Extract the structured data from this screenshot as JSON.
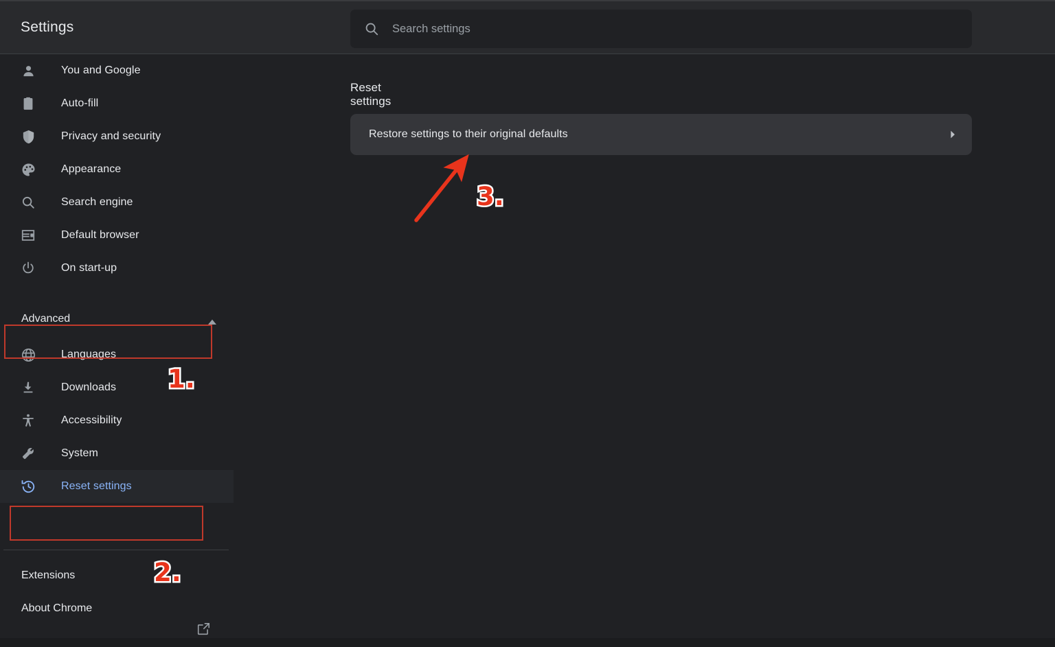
{
  "header": {
    "title": "Settings",
    "search": {
      "placeholder": "Search settings",
      "value": "",
      "icon": "search-icon"
    }
  },
  "sidebar": {
    "items": [
      {
        "label": "You and Google",
        "icon": "person-icon",
        "selected": false
      },
      {
        "label": "Auto-fill",
        "icon": "clipboard-icon",
        "selected": false
      },
      {
        "label": "Privacy and security",
        "icon": "shield-icon",
        "selected": false
      },
      {
        "label": "Appearance",
        "icon": "palette-icon",
        "selected": false
      },
      {
        "label": "Search engine",
        "icon": "magnifier-icon",
        "selected": false
      },
      {
        "label": "Default browser",
        "icon": "browser-window-icon",
        "selected": false
      },
      {
        "label": "On start-up",
        "icon": "power-icon",
        "selected": false
      }
    ],
    "advanced": {
      "label": "Advanced",
      "expanded": true,
      "icon": "chevron-up-icon"
    },
    "advanced_items": [
      {
        "label": "Languages",
        "icon": "globe-icon",
        "selected": false
      },
      {
        "label": "Downloads",
        "icon": "download-icon",
        "selected": false
      },
      {
        "label": "Accessibility",
        "icon": "accessibility-icon",
        "selected": false
      },
      {
        "label": "System",
        "icon": "wrench-icon",
        "selected": false
      },
      {
        "label": "Reset settings",
        "icon": "history-icon",
        "selected": true
      }
    ],
    "footer_items": [
      {
        "label": "Extensions",
        "icon": "external-link-icon"
      },
      {
        "label": "About Chrome",
        "icon": null
      }
    ]
  },
  "main": {
    "section_title": "Reset settings",
    "reset_card": {
      "label": "Restore settings to their original defaults",
      "chevron": "chevron-right-icon"
    }
  },
  "annotations": {
    "color": "#e8341c",
    "box_color": "#c0392b",
    "numbers": [
      {
        "id": "1",
        "text": "1."
      },
      {
        "id": "2",
        "text": "2."
      },
      {
        "id": "3",
        "text": "3."
      }
    ],
    "arrow": {
      "name": "pointer-arrow",
      "direction": "up-right"
    }
  },
  "colors": {
    "background": "#202124",
    "header_background": "#292a2d",
    "card_background": "#35363a",
    "accent_blue": "#8ab4f8",
    "text_primary": "#e8eaed",
    "text_secondary": "#9aa0a6"
  }
}
